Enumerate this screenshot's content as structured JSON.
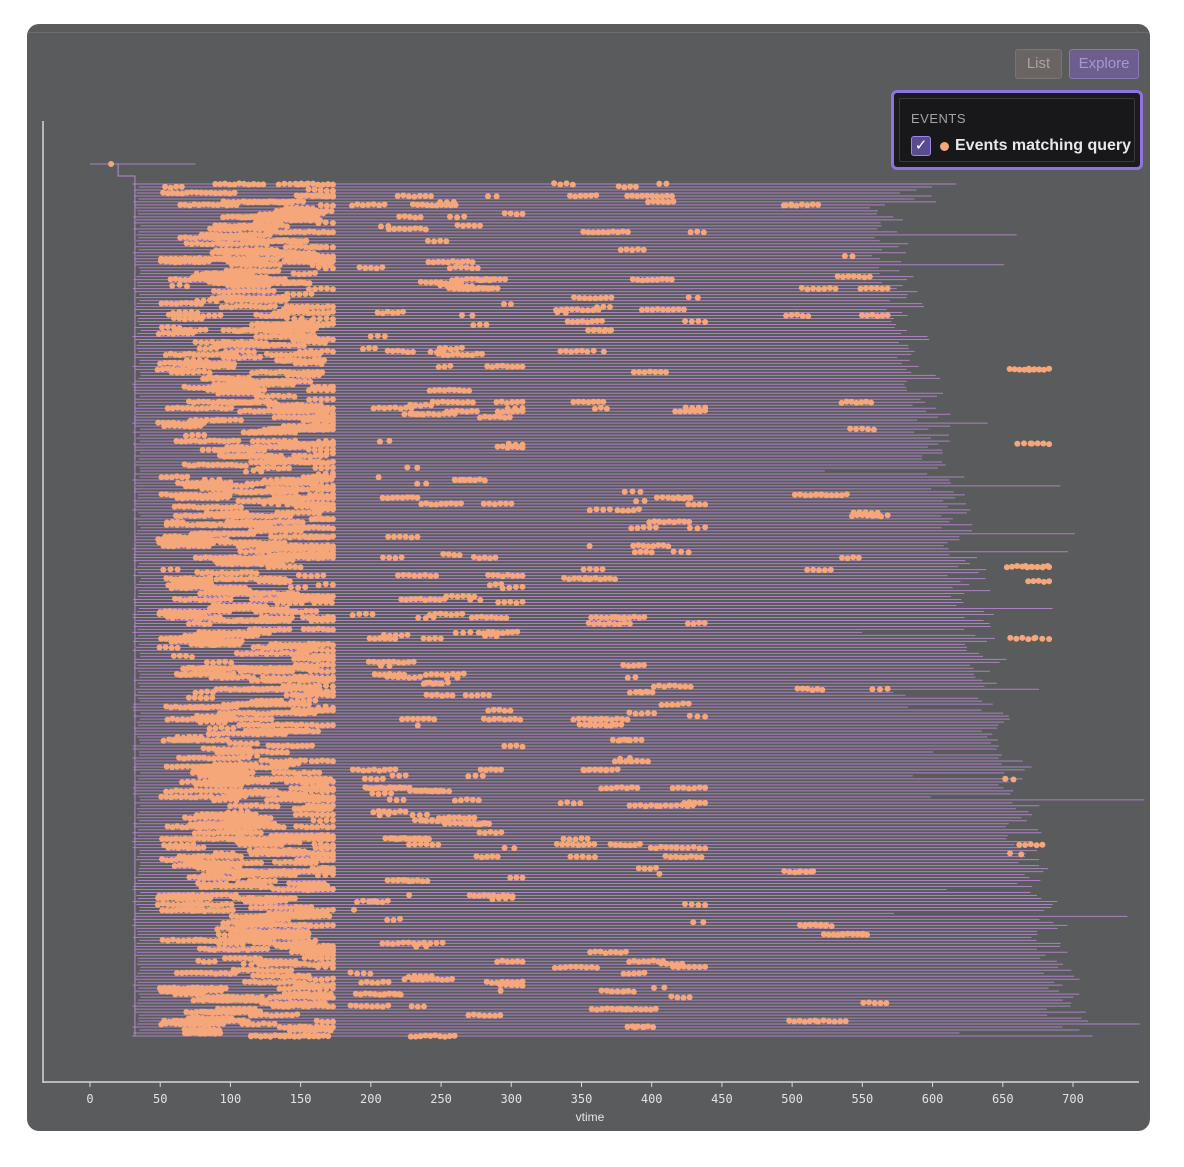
{
  "toolbar": {
    "list_label": "List",
    "explore_label": "Explore"
  },
  "legend": {
    "title": "EVENTS",
    "item_label": "Events matching query",
    "checked": true
  },
  "colors": {
    "panel_bg": "#5a5b5d",
    "trace_line": "#b98ad0",
    "event_dot": "#f6a77a",
    "accent": "#8d74e0"
  },
  "chart_data": {
    "type": "scatter",
    "description_of_marks": "one horizontal span per trace, orange points for events along each span",
    "xlabel": "vtime",
    "ylabel": "",
    "xlim": [
      -35,
      745
    ],
    "xticks": [
      0,
      50,
      100,
      150,
      200,
      250,
      300,
      350,
      400,
      450,
      500,
      550,
      600,
      650,
      700
    ],
    "tick_labels": [
      "0",
      "50",
      "100",
      "150",
      "200",
      "250",
      "300",
      "350",
      "400",
      "450",
      "500",
      "550",
      "600",
      "650",
      "700"
    ],
    "grid": false,
    "legend_position": "top-right",
    "trace_count": 286,
    "root_trace": {
      "start": 0,
      "end": 75,
      "event": 15
    },
    "traces_start_range": [
      30,
      50
    ],
    "traces_end_range": [
      560,
      700
    ],
    "event_clusters": [
      {
        "x_from": 48,
        "x_to": 165,
        "density": "very high"
      },
      {
        "x_from": 185,
        "x_to": 300,
        "density": "high"
      },
      {
        "x_from": 330,
        "x_to": 430,
        "density": "medium"
      },
      {
        "x_from": 490,
        "x_to": 560,
        "density": "low"
      },
      {
        "x_from": 650,
        "x_to": 675,
        "density": "sparse"
      }
    ]
  }
}
